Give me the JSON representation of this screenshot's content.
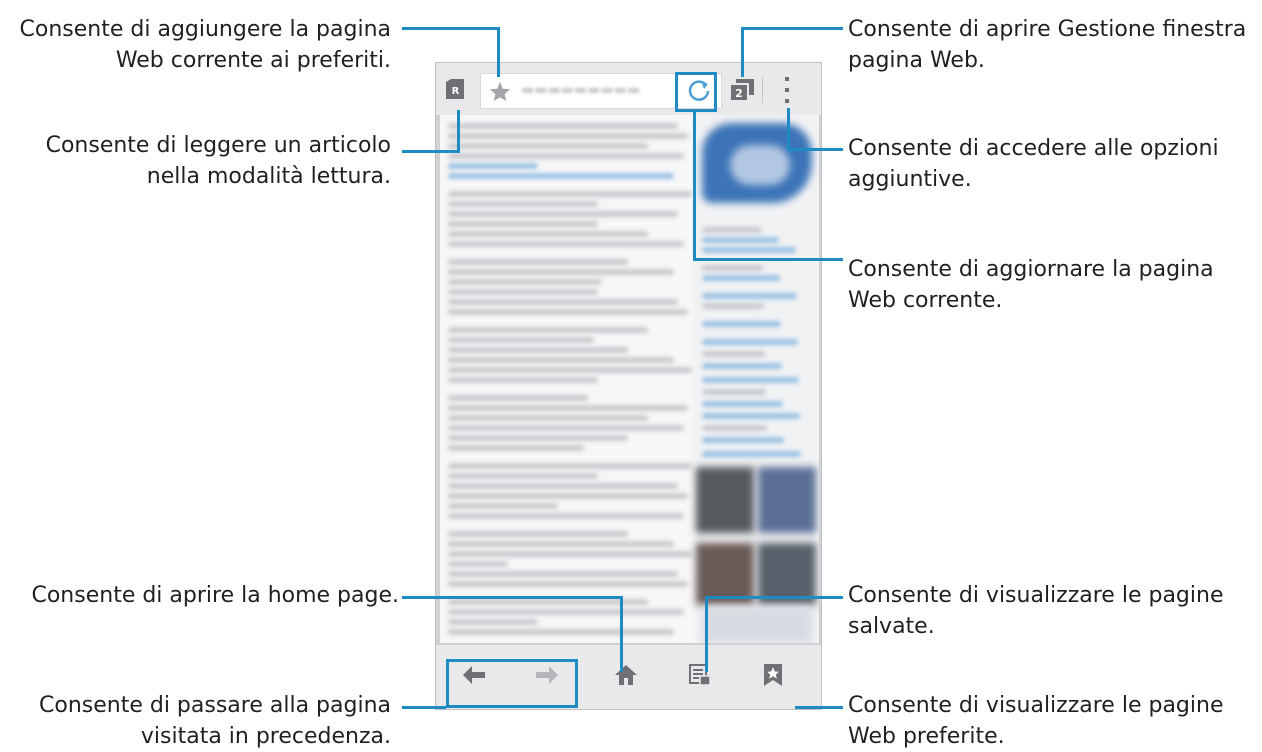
{
  "annotations": {
    "bookmark_star": [
      "Consente di aggiungere la pagina",
      "Web corrente ai preferiti."
    ],
    "reader_mode": [
      "Consente di leggere un articolo",
      "nella modalità lettura."
    ],
    "home": [
      "Consente di aprire la home page."
    ],
    "back_forward": [
      "Consente di passare alla pagina",
      "visitata in precedenza."
    ],
    "window_manager": [
      "Consente di aprire Gestione finestra",
      "pagina Web."
    ],
    "more_options": [
      "Consente di accedere alle opzioni",
      "aggiuntive."
    ],
    "refresh": [
      "Consente di aggiornare la pagina",
      "Web corrente."
    ],
    "saved_pages": [
      "Consente di visualizzare le pagine",
      "salvate."
    ],
    "bookmarks": [
      "Consente di visualizzare le pagine",
      "Web preferite."
    ]
  },
  "browser": {
    "reader_icon_text": "R",
    "window_count": "2"
  },
  "colors": {
    "callout_line": "#1e8bc3",
    "toolbar_bg": "#e8e9ea",
    "icon_gray": "#6e7073"
  }
}
